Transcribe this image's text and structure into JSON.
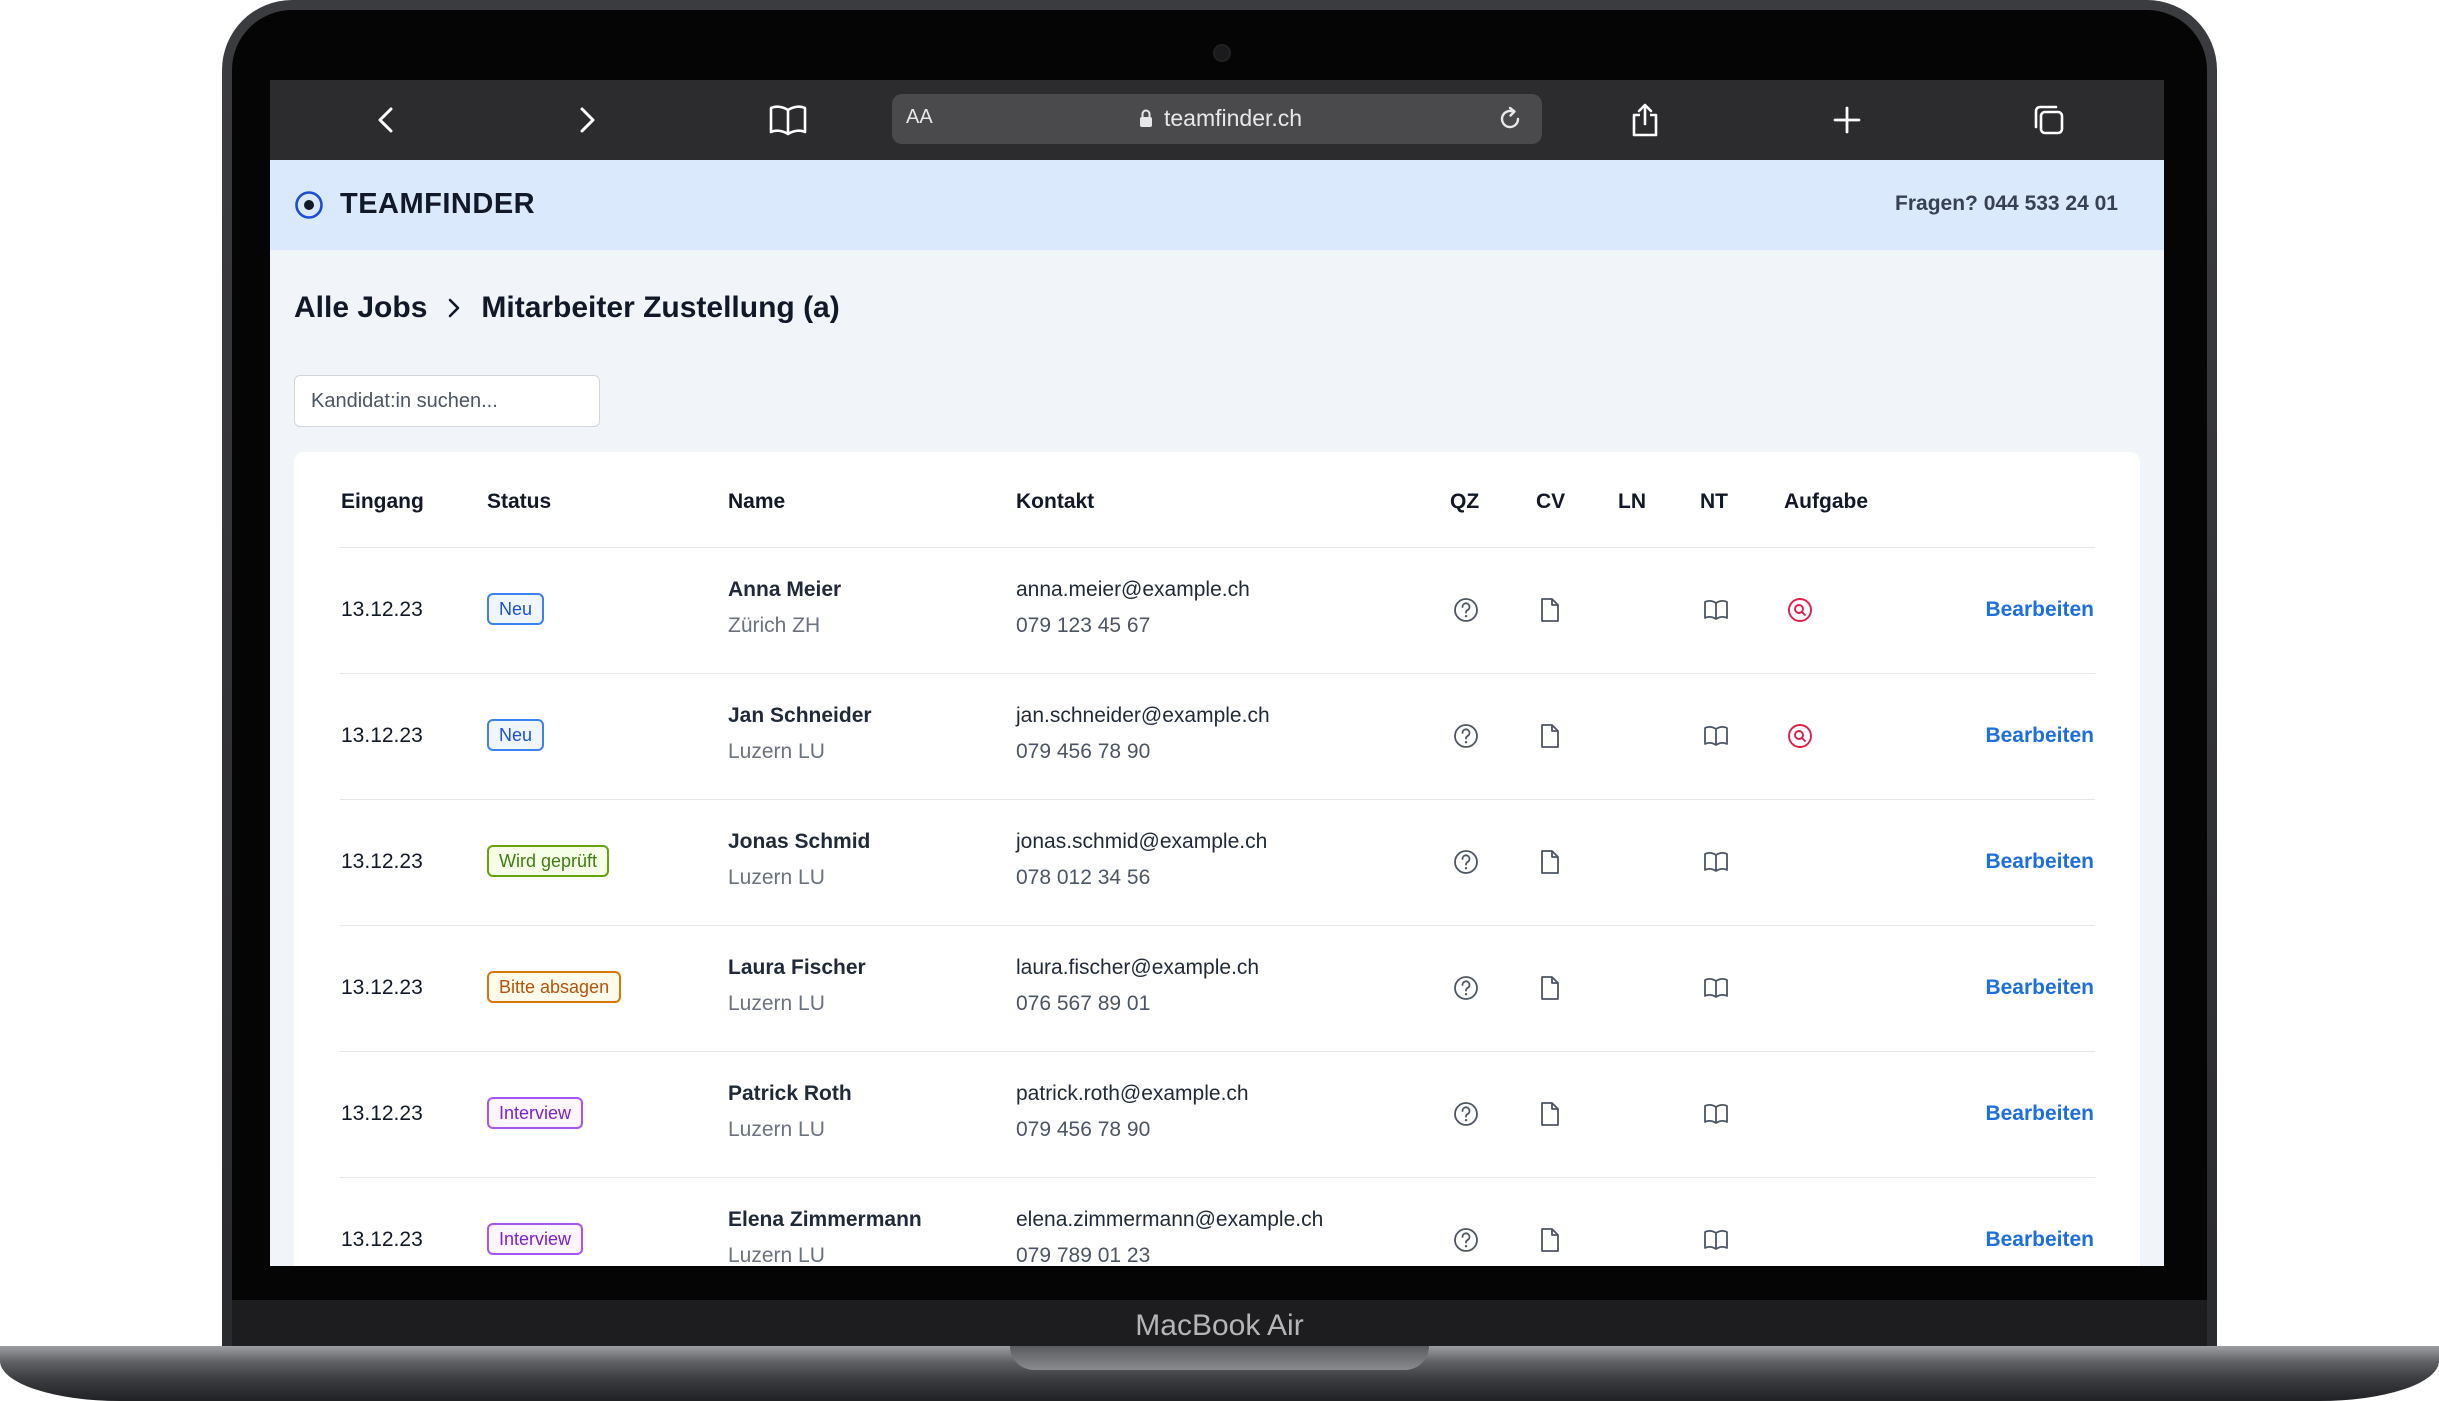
{
  "device": {
    "model_label": "MacBook Air"
  },
  "browser": {
    "aa_label": "AA",
    "url": "teamfinder.ch"
  },
  "header": {
    "brand": "TEAMFINDER",
    "hotline": "Fragen? 044 533 24 01"
  },
  "breadcrumb": {
    "root": "Alle Jobs",
    "current": "Mitarbeiter Zustellung (a)"
  },
  "search": {
    "placeholder": "Kandidat:in suchen...",
    "value": ""
  },
  "table": {
    "columns": [
      "Eingang",
      "Status",
      "Name",
      "Kontakt",
      "QZ",
      "CV",
      "LN",
      "NT",
      "Aufgabe"
    ],
    "edit_label": "Bearbeiten",
    "rows": [
      {
        "date": "13.12.23",
        "status": "Neu",
        "status_type": "neu",
        "name": "Anna Meier",
        "city": "Zürich ZH",
        "email": "anna.meier@example.ch",
        "phone": "079 123 45 67",
        "task_icon": true
      },
      {
        "date": "13.12.23",
        "status": "Neu",
        "status_type": "neu",
        "name": "Jan Schneider",
        "city": "Luzern LU",
        "email": "jan.schneider@example.ch",
        "phone": "079 456 78 90",
        "task_icon": true
      },
      {
        "date": "13.12.23",
        "status": "Wird geprüft",
        "status_type": "review",
        "name": "Jonas Schmid",
        "city": "Luzern LU",
        "email": "jonas.schmid@example.ch",
        "phone": "078 012 34 56",
        "task_icon": false
      },
      {
        "date": "13.12.23",
        "status": "Bitte absagen",
        "status_type": "reject",
        "name": "Laura Fischer",
        "city": "Luzern LU",
        "email": "laura.fischer@example.ch",
        "phone": "076 567 89 01",
        "task_icon": false
      },
      {
        "date": "13.12.23",
        "status": "Interview",
        "status_type": "interview",
        "name": "Patrick Roth",
        "city": "Luzern LU",
        "email": "patrick.roth@example.ch",
        "phone": "079 456 78 90",
        "task_icon": false
      },
      {
        "date": "13.12.23",
        "status": "Interview",
        "status_type": "interview",
        "name": "Elena Zimmermann",
        "city": "Luzern LU",
        "email": "elena.zimmermann@example.ch",
        "phone": "079 789 01 23",
        "task_icon": false
      }
    ]
  },
  "icons": {
    "browser_toolbar": [
      "back-icon",
      "forward-icon",
      "bookmarks-icon",
      "share-icon",
      "new-tab-icon",
      "tabs-icon"
    ],
    "row_icons": [
      "question-circle-icon",
      "document-icon",
      "book-icon",
      "search-alert-icon"
    ]
  },
  "colors": {
    "header_bg": "#dbe9fd",
    "link": "#1d6fe0",
    "status": {
      "neu": {
        "text": "#1d4ed8",
        "border": "#3b82f6",
        "bg": "#eff6ff"
      },
      "review": {
        "text": "#3f7d12",
        "border": "#65a30d",
        "bg": "#f7fee7"
      },
      "reject": {
        "text": "#b45309",
        "border": "#d97706",
        "bg": "#fffbeb"
      },
      "interview": {
        "text": "#7e22ce",
        "border": "#a855f7",
        "bg": "#faf5ff"
      }
    },
    "task_icon": "#e11d48"
  }
}
